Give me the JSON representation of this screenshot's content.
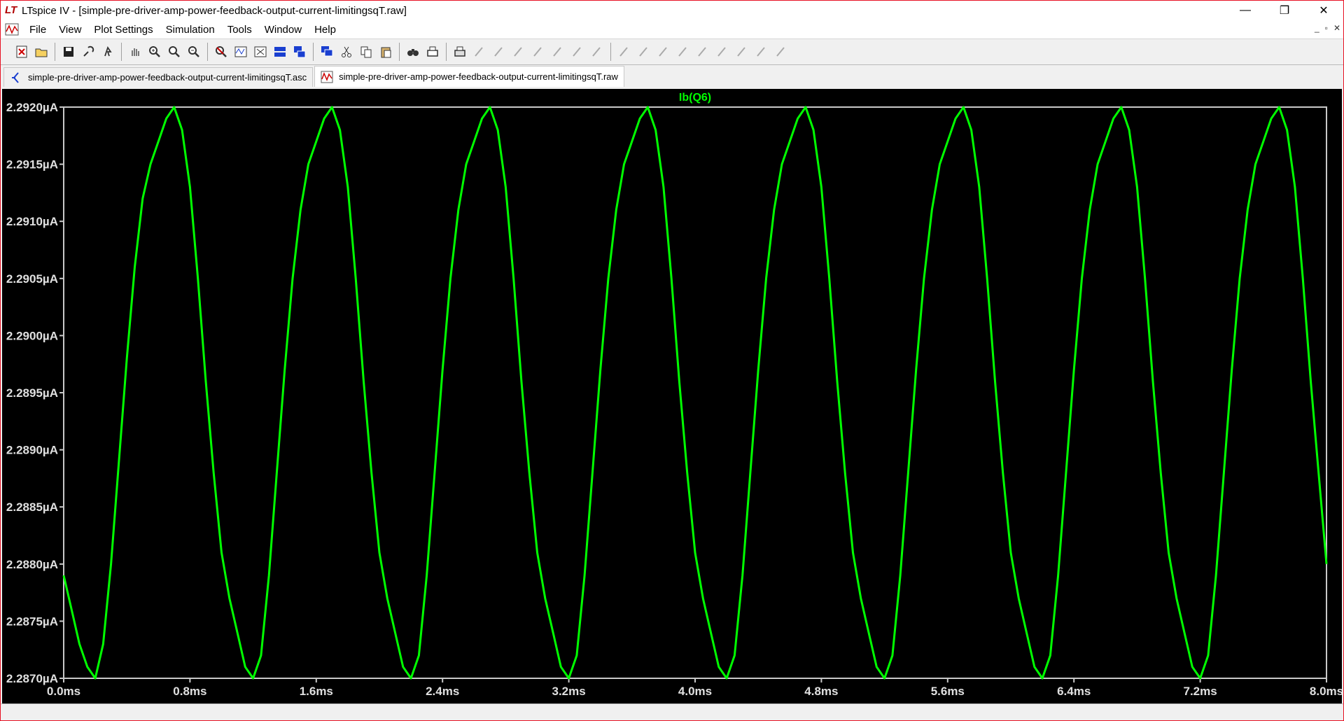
{
  "window": {
    "app_name": "LTspice IV",
    "title": "LTspice IV - [simple-pre-driver-amp-power-feedback-output-current-limitingsqT.raw]",
    "controls": {
      "minimize": "—",
      "restore": "❐",
      "close": "✕"
    }
  },
  "menu": {
    "items": [
      "File",
      "View",
      "Plot Settings",
      "Simulation",
      "Tools",
      "Window",
      "Help"
    ],
    "mdi_controls": {
      "minimize": "_",
      "restore": "▫",
      "close": "✕"
    }
  },
  "toolbar": {
    "icons": [
      "new-schematic-icon",
      "open-icon",
      "save-icon",
      "control-panel-icon",
      "run-icon",
      "pan-icon",
      "zoom-in-icon",
      "zoom-back-icon",
      "zoom-out-icon",
      "zoom-fit-icon",
      "autorange-icon",
      "delete-traces-icon",
      "tile-horizontal-icon",
      "cascade-icon",
      "tile-vertical-icon",
      "cut-icon",
      "copy-icon",
      "paste-icon",
      "find-icon",
      "print-preview-icon",
      "print-icon",
      "wire-icon",
      "ground-icon",
      "label-icon",
      "resistor-icon",
      "capacitor-icon",
      "inductor-icon",
      "diode-icon",
      "component-icon",
      "move-icon",
      "drag-icon",
      "undo-icon",
      "redo-icon",
      "rotate-icon",
      "mirror-icon",
      "text-icon",
      "spice-directive-icon"
    ]
  },
  "tabs": [
    {
      "label": "simple-pre-driver-amp-power-feedback-output-current-limitingsqT.asc",
      "icon": "schematic-icon",
      "active": false
    },
    {
      "label": "simple-pre-driver-amp-power-feedback-output-current-limitingsqT.raw",
      "icon": "waveform-icon",
      "active": true
    }
  ],
  "colors": {
    "plot_bg": "#000000",
    "grid": "#c8c8c8",
    "trace": "#00ff00",
    "axis_text": "#e0e0e0"
  },
  "chart_data": {
    "type": "line",
    "title": "",
    "series": [
      {
        "name": "Ib(Q6)",
        "color": "#00ff00",
        "x_ms": [
          0.0,
          0.05,
          0.1,
          0.15,
          0.2,
          0.25,
          0.3,
          0.35,
          0.4,
          0.45,
          0.5,
          0.55,
          0.6,
          0.65,
          0.7,
          0.75,
          0.8,
          0.85,
          0.9,
          0.95,
          1.0,
          1.05,
          1.1,
          1.15,
          1.2,
          1.25,
          1.3,
          1.35,
          1.4,
          1.45,
          1.5,
          1.55,
          1.6,
          1.65,
          1.7,
          1.75,
          1.8,
          1.85,
          1.9,
          1.95,
          2.0,
          2.05,
          2.1,
          2.15,
          2.2,
          2.25,
          2.3,
          2.35,
          2.4,
          2.45,
          2.5,
          2.55,
          2.6,
          2.65,
          2.7,
          2.75,
          2.8,
          2.85,
          2.9,
          2.95,
          3.0,
          3.05,
          3.1,
          3.15,
          3.2,
          3.25,
          3.3,
          3.35,
          3.4,
          3.45,
          3.5,
          3.55,
          3.6,
          3.65,
          3.7,
          3.75,
          3.8,
          3.85,
          3.9,
          3.95,
          4.0,
          4.05,
          4.1,
          4.15,
          4.2,
          4.25,
          4.3,
          4.35,
          4.4,
          4.45,
          4.5,
          4.55,
          4.6,
          4.65,
          4.7,
          4.75,
          4.8,
          4.85,
          4.9,
          4.95,
          5.0,
          5.05,
          5.1,
          5.15,
          5.2,
          5.25,
          5.3,
          5.35,
          5.4,
          5.45,
          5.5,
          5.55,
          5.6,
          5.65,
          5.7,
          5.75,
          5.8,
          5.85,
          5.9,
          5.95,
          6.0,
          6.05,
          6.1,
          6.15,
          6.2,
          6.25,
          6.3,
          6.35,
          6.4,
          6.45,
          6.5,
          6.55,
          6.6,
          6.65,
          6.7,
          6.75,
          6.8,
          6.85,
          6.9,
          6.95,
          7.0,
          7.05,
          7.1,
          7.15,
          7.2,
          7.25,
          7.3,
          7.35,
          7.4,
          7.45,
          7.5,
          7.55,
          7.6,
          7.65,
          7.7,
          7.75,
          7.8,
          7.85,
          7.9,
          7.95,
          8.0
        ],
        "y_uA": [
          2.2879,
          2.2876,
          2.2873,
          2.2871,
          2.287,
          2.2873,
          2.288,
          2.2889,
          2.2898,
          2.2906,
          2.2912,
          2.2915,
          2.2917,
          2.2919,
          2.292,
          2.2918,
          2.2913,
          2.2905,
          2.2896,
          2.2888,
          2.2881,
          2.2877,
          2.2874,
          2.2871,
          2.287,
          2.2872,
          2.2879,
          2.2888,
          2.2897,
          2.2905,
          2.2911,
          2.2915,
          2.2917,
          2.2919,
          2.292,
          2.2918,
          2.2913,
          2.2905,
          2.2896,
          2.2888,
          2.2881,
          2.2877,
          2.2874,
          2.2871,
          2.287,
          2.2872,
          2.2879,
          2.2888,
          2.2897,
          2.2905,
          2.2911,
          2.2915,
          2.2917,
          2.2919,
          2.292,
          2.2918,
          2.2913,
          2.2905,
          2.2896,
          2.2888,
          2.2881,
          2.2877,
          2.2874,
          2.2871,
          2.287,
          2.2872,
          2.2879,
          2.2888,
          2.2897,
          2.2905,
          2.2911,
          2.2915,
          2.2917,
          2.2919,
          2.292,
          2.2918,
          2.2913,
          2.2905,
          2.2896,
          2.2888,
          2.2881,
          2.2877,
          2.2874,
          2.2871,
          2.287,
          2.2872,
          2.2879,
          2.2888,
          2.2897,
          2.2905,
          2.2911,
          2.2915,
          2.2917,
          2.2919,
          2.292,
          2.2918,
          2.2913,
          2.2905,
          2.2896,
          2.2888,
          2.2881,
          2.2877,
          2.2874,
          2.2871,
          2.287,
          2.2872,
          2.2879,
          2.2888,
          2.2897,
          2.2905,
          2.2911,
          2.2915,
          2.2917,
          2.2919,
          2.292,
          2.2918,
          2.2913,
          2.2905,
          2.2896,
          2.2888,
          2.2881,
          2.2877,
          2.2874,
          2.2871,
          2.287,
          2.2872,
          2.2879,
          2.2888,
          2.2897,
          2.2905,
          2.2911,
          2.2915,
          2.2917,
          2.2919,
          2.292,
          2.2918,
          2.2913,
          2.2905,
          2.2896,
          2.2888,
          2.2881,
          2.2877,
          2.2874,
          2.2871,
          2.287,
          2.2872,
          2.2879,
          2.2888,
          2.2897,
          2.2905,
          2.2911,
          2.2915,
          2.2917,
          2.2919,
          2.292,
          2.2918,
          2.2913,
          2.2905,
          2.2896,
          2.2888,
          2.288
        ]
      }
    ],
    "xlabel": "",
    "ylabel": "",
    "xlim": [
      0.0,
      8.0
    ],
    "ylim": [
      2.287,
      2.292
    ],
    "x_ticks": [
      "0.0ms",
      "0.8ms",
      "1.6ms",
      "2.4ms",
      "3.2ms",
      "4.0ms",
      "4.8ms",
      "5.6ms",
      "6.4ms",
      "7.2ms",
      "8.0ms"
    ],
    "y_ticks": [
      "2.2920µA",
      "2.2915µA",
      "2.2910µA",
      "2.2905µA",
      "2.2900µA",
      "2.2895µA",
      "2.2890µA",
      "2.2885µA",
      "2.2880µA",
      "2.2875µA",
      "2.2870µA"
    ],
    "grid": false,
    "legend": "top-center"
  }
}
